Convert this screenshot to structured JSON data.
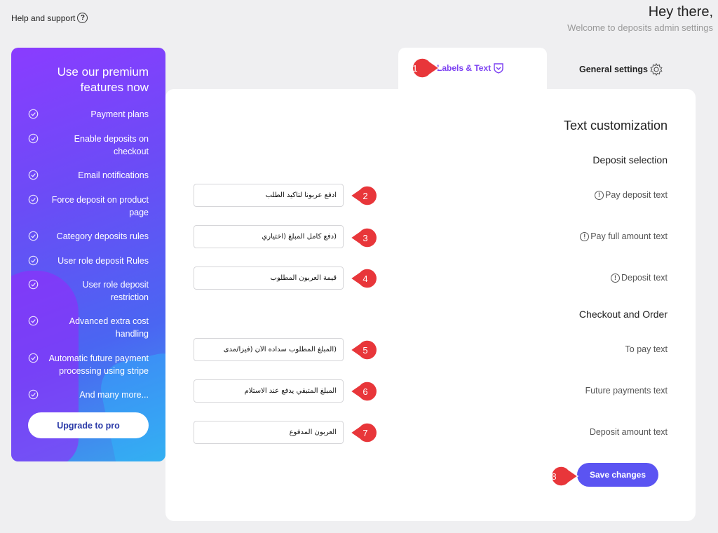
{
  "help": {
    "label": "Help and support",
    "icon": "question-circle-icon"
  },
  "greeting": {
    "title": "Hey there,",
    "subtitle": "Welcome to deposits admin settings"
  },
  "promo": {
    "title": "Use our premium features now",
    "features": [
      "Payment plans",
      "Enable deposits on checkout",
      "Email notifications",
      "Force deposit on product page",
      "Category deposits rules",
      "User role deposit Rules",
      "User role deposit restriction",
      "Advanced extra cost handling",
      "Automatic future payment processing using stripe",
      "And many more..."
    ],
    "upgrade_label": "Upgrade to pro"
  },
  "tabs": {
    "labels_text": "Labels & Text",
    "general": "General settings"
  },
  "main": {
    "title": "Text customization",
    "section1": "Deposit selection",
    "section2": "Checkout and Order",
    "fields": [
      {
        "label": "Pay deposit text",
        "value": "ادفع عربوناً لتأكيد الطلب"
      },
      {
        "label": "Pay full amount text",
        "value": "(دفع كامل المبلغ (اختياري"
      },
      {
        "label": "Deposit text",
        "value": "قيمة العربون المطلوب"
      },
      {
        "label": "To pay text",
        "value": "(المبلغ المطلوب سداده الأن (فيزا/مدى"
      },
      {
        "label": "Future payments text",
        "value": "المبلغ المتبقي يدفع عند الاستلام"
      },
      {
        "label": "Deposit amount text",
        "value": "العربون المدفوع"
      }
    ],
    "save_label": "Save changes"
  },
  "markers": [
    "1",
    "2",
    "3",
    "4",
    "5",
    "6",
    "7",
    "8"
  ],
  "colors": {
    "accent": "#5b54f2",
    "tab_active": "#7b3ff2",
    "marker": "#e8363a"
  }
}
